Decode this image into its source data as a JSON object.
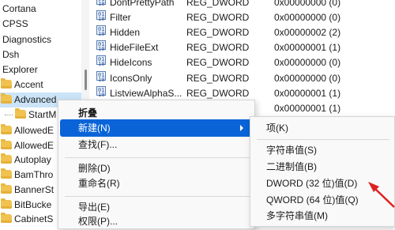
{
  "tree": {
    "items": [
      {
        "label": "Cortana",
        "folder": false
      },
      {
        "label": "CPSS",
        "folder": false
      },
      {
        "label": "Diagnostics",
        "folder": false
      },
      {
        "label": "Dsh",
        "folder": false
      },
      {
        "label": "Explorer",
        "folder": false
      },
      {
        "label": "Accent",
        "folder": true
      },
      {
        "label": "Advanced",
        "folder": true,
        "selected": true
      },
      {
        "label": "StartM",
        "folder": true
      },
      {
        "label": "AllowedE",
        "folder": true
      },
      {
        "label": "AllowedE",
        "folder": true
      },
      {
        "label": "Autoplay",
        "folder": true
      },
      {
        "label": "BamThro",
        "folder": true
      },
      {
        "label": "BannerSt",
        "folder": true
      },
      {
        "label": "BitBucke",
        "folder": true
      },
      {
        "label": "CabinetS",
        "folder": true
      }
    ]
  },
  "values": {
    "rows": [
      {
        "name": "DontPrettyPath",
        "type": "REG_DWORD",
        "data": "0x00000000 (0)"
      },
      {
        "name": "Filter",
        "type": "REG_DWORD",
        "data": "0x00000000 (0)"
      },
      {
        "name": "Hidden",
        "type": "REG_DWORD",
        "data": "0x00000002 (2)"
      },
      {
        "name": "HideFileExt",
        "type": "REG_DWORD",
        "data": "0x00000001 (1)"
      },
      {
        "name": "HideIcons",
        "type": "REG_DWORD",
        "data": "0x00000000 (0)"
      },
      {
        "name": "IconsOnly",
        "type": "REG_DWORD",
        "data": "0x00000000 (0)"
      },
      {
        "name": "ListviewAlphaS...",
        "type": "REG_DWORD",
        "data": "0x00000001 (1)"
      },
      {
        "name": "",
        "type": "",
        "data": "0x00000001 (1)"
      }
    ]
  },
  "context_menu": {
    "collapse": "折叠",
    "new": "新建(N)",
    "find": "查找(F)...",
    "delete": "删除(D)",
    "rename": "重命名(R)",
    "export": "导出(E)",
    "permissions": "权限(P)..."
  },
  "submenu": {
    "key": "项(K)",
    "string_value": "字符串值(S)",
    "binary_value": "二进制值(B)",
    "dword_value": "DWORD (32 位)值(D)",
    "qword_value": "QWORD (64 位)值(Q)",
    "multi_string_value": "多字符串值(M)"
  },
  "colors": {
    "highlight": "#0a64d8",
    "selection": "#cce4f7",
    "annotation_arrow": "#e02020"
  }
}
